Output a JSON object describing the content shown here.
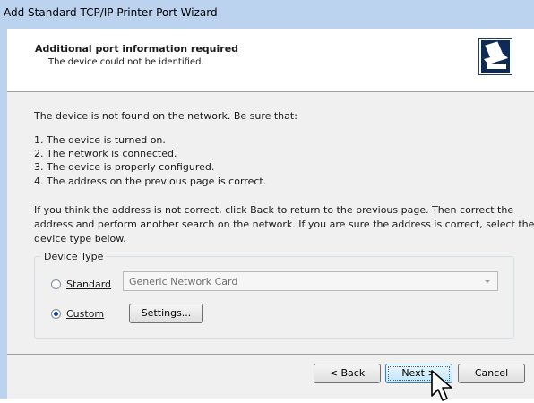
{
  "window": {
    "title": "Add Standard TCP/IP Printer Port Wizard"
  },
  "header": {
    "title": "Additional port information required",
    "subtitle": "The device could not be identified.",
    "icon": "printer-icon"
  },
  "body": {
    "intro": "The device is not found on the network.  Be sure that:",
    "checklist": [
      "1.  The device is turned on.",
      "2.  The network is connected.",
      "3.  The device is properly configured.",
      "4.  The address on the previous page is correct."
    ],
    "advice_lines": [
      "If you think the address is not correct, click Back to return to the previous page.  Then correct the",
      "address and perform another search on the network.  If you are sure the address is correct, select the",
      "device type below."
    ]
  },
  "device_type": {
    "group_label": "Device Type",
    "standard": {
      "label": "Standard",
      "mnemonic": "S",
      "selected": false
    },
    "custom": {
      "label": "Custom",
      "mnemonic": "C",
      "selected": true
    },
    "standard_value": "Generic Network Card",
    "settings_label": "Settings..."
  },
  "footer": {
    "back_label": "< Back",
    "next_label": "Next >",
    "cancel_label": "Cancel"
  },
  "colors": {
    "titlebar": "#bcd3ef",
    "dialog_bg": "#f0f0f0",
    "focus_border": "#3c7fb1"
  }
}
